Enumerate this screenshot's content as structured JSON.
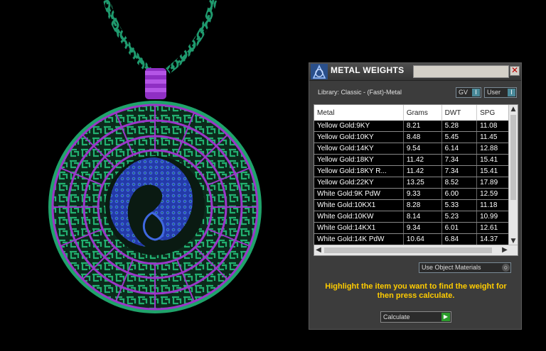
{
  "panel": {
    "title": "METAL WEIGHTS",
    "close_glyph": "✕",
    "library_label": "Library: Classic - (Fast)-Metal",
    "gv_combo": "GV",
    "user_combo": "User",
    "object_materials_combo": "Use Object Materials",
    "message": "Highlight the item you want to find the weight for then press calculate.",
    "calculate_label": "Calculate"
  },
  "table": {
    "headers": [
      "Metal",
      "Grams",
      "DWT",
      "SPG"
    ],
    "rows": [
      [
        "Yellow Gold:9KY",
        "8.21",
        "5.28",
        "11.08"
      ],
      [
        "Yellow Gold:10KY",
        "8.48",
        "5.45",
        "11.45"
      ],
      [
        "Yellow Gold:14KY",
        "9.54",
        "6.14",
        "12.88"
      ],
      [
        "Yellow Gold:18KY",
        "11.42",
        "7.34",
        "15.41"
      ],
      [
        "Yellow Gold:18KY R...",
        "11.42",
        "7.34",
        "15.41"
      ],
      [
        "Yellow Gold:22KY",
        "13.25",
        "8.52",
        "17.89"
      ],
      [
        "White Gold:9K PdW",
        "9.33",
        "6.00",
        "12.59"
      ],
      [
        "White Gold:10KX1",
        "8.28",
        "5.33",
        "11.18"
      ],
      [
        "White Gold:10KW",
        "8.14",
        "5.23",
        "10.99"
      ],
      [
        "White Gold:14KX1",
        "9.34",
        "6.01",
        "12.61"
      ],
      [
        "White Gold:14K PdW",
        "10.64",
        "6.84",
        "14.37"
      ]
    ]
  },
  "icons": {
    "logo": "rhino-logo-icon",
    "close": "close-icon",
    "scroll_up": "▲",
    "scroll_down": "▼",
    "scroll_left": "◀",
    "scroll_right": "▶",
    "combo_arrow": "I",
    "go": "▶"
  },
  "colors": {
    "chain": "#1f9a6e",
    "bail": "#a23fd6",
    "pendant_green": "#1fa36a",
    "pendant_purple": "#9b36c9",
    "pendant_blue": "#2a45c8",
    "message": "#ffcc00",
    "panel_bg": "#3c3c3c"
  }
}
